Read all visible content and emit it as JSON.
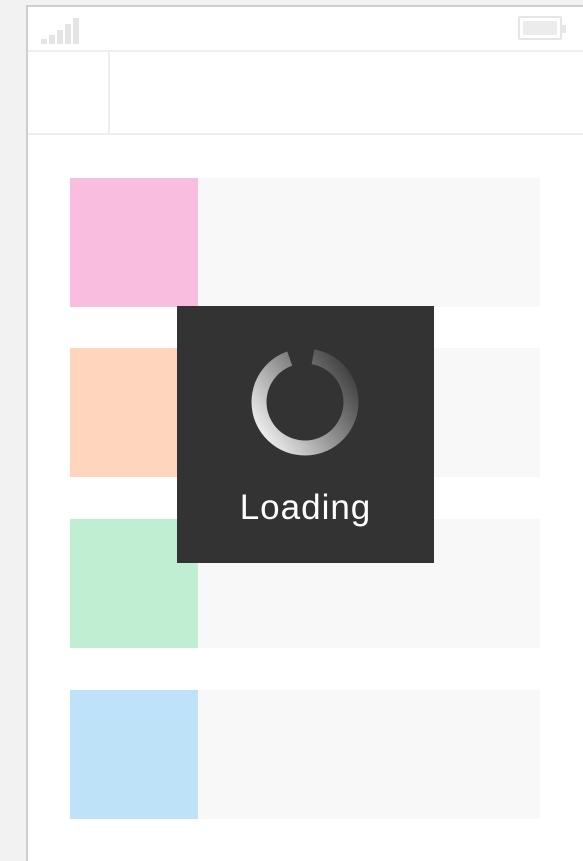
{
  "loading": {
    "label": "Loading"
  },
  "cards": [
    {
      "accent": "#f8bddf"
    },
    {
      "accent": "#ffd5bd"
    },
    {
      "accent": "#c0eed2"
    },
    {
      "accent": "#bee2f8"
    }
  ],
  "colors": {
    "overlay_bg": "#333333",
    "card_bg": "#f8f8f8",
    "placeholder_gray": "#e4e4e4"
  },
  "icons": {
    "signal": "signal-strength-icon",
    "battery": "battery-icon",
    "spinner": "loading-spinner-icon"
  }
}
